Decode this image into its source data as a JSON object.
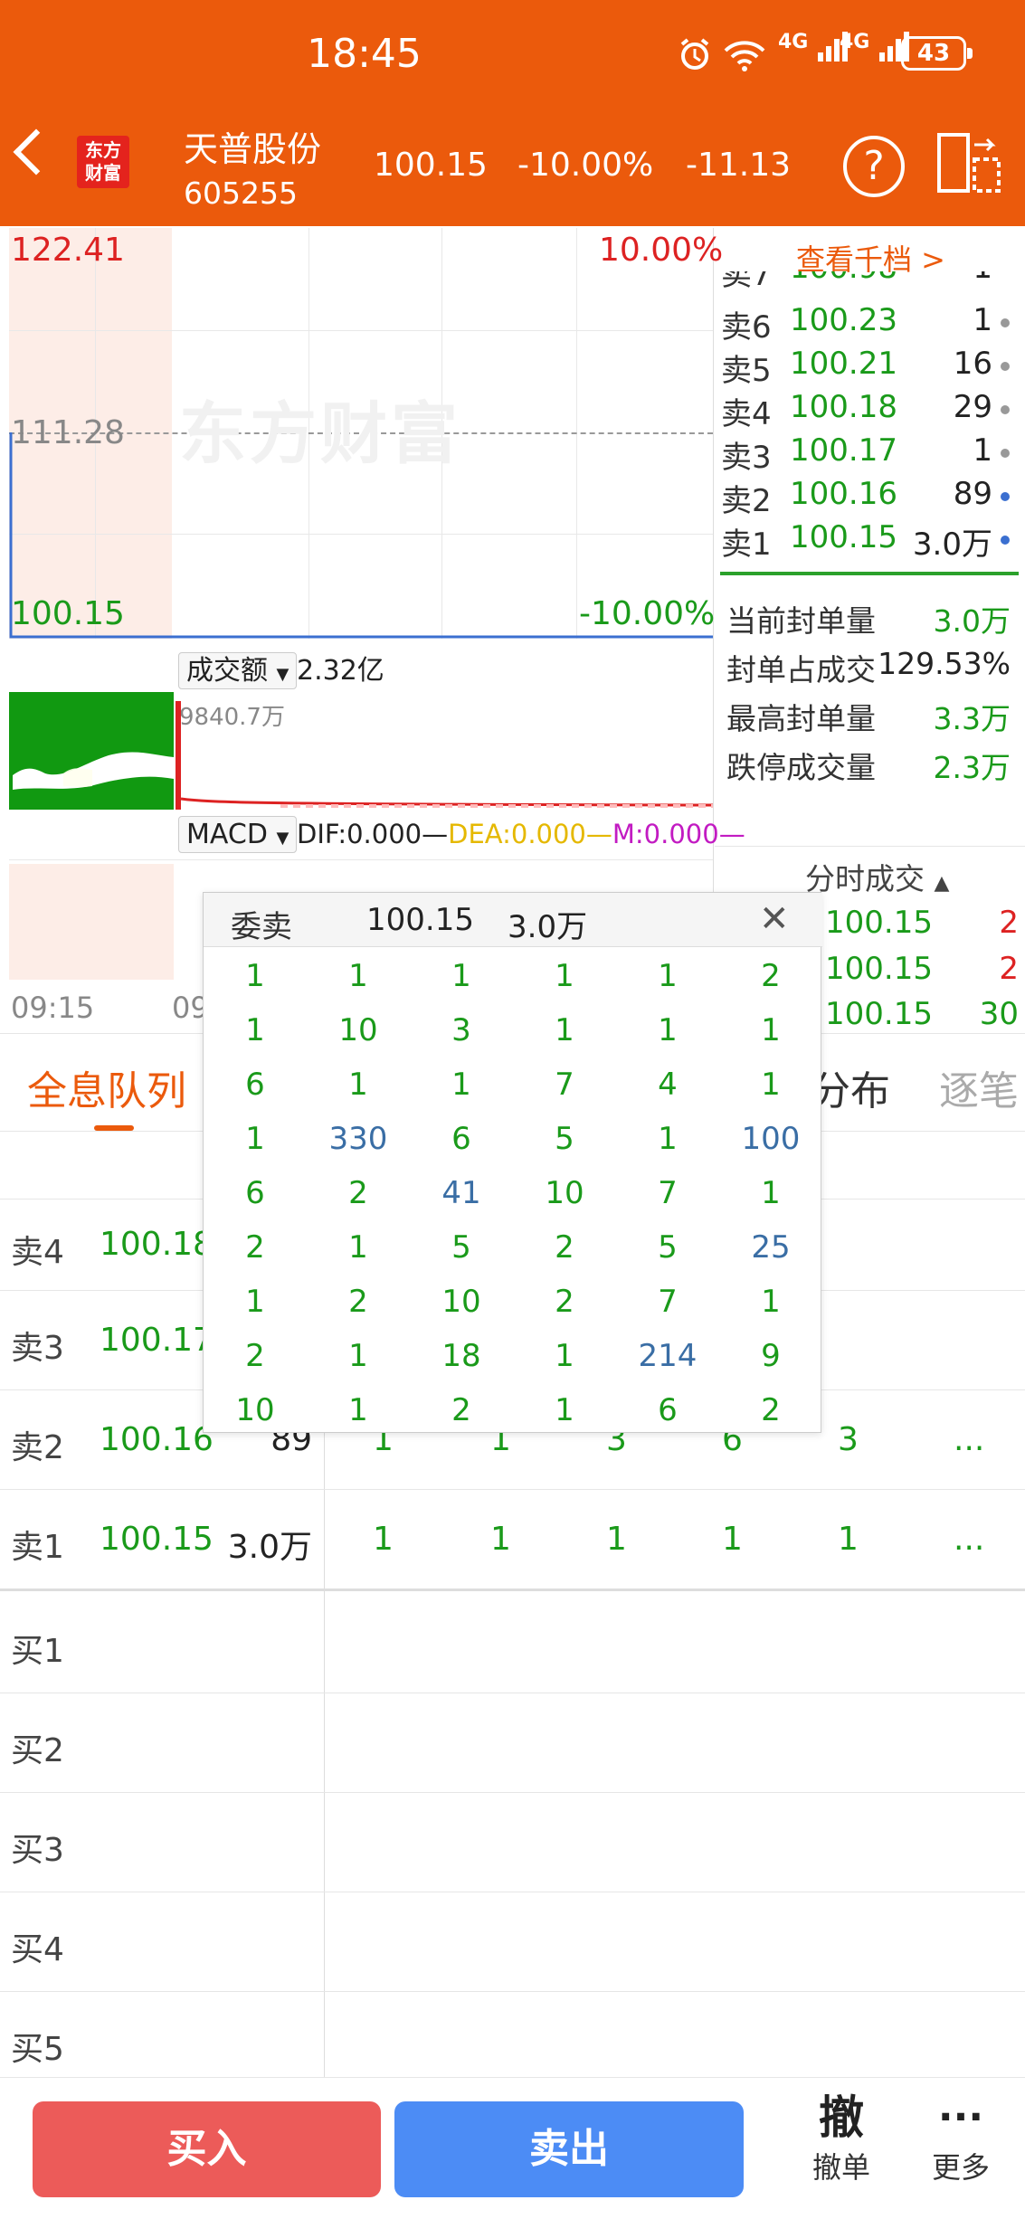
{
  "status_bar": {
    "time": "18:45",
    "net1": "4G",
    "net2": "4G",
    "battery": "43"
  },
  "header": {
    "logo_text_line1": "东方",
    "logo_text_line2": "财富",
    "stock_name": "天普股份",
    "stock_code": "605255",
    "price": "100.15",
    "change_pct": "-10.00%",
    "change_abs": "-11.13",
    "help_label": "?"
  },
  "chart": {
    "high_price": "122.41",
    "high_pct": "10.00%",
    "prev_close": "111.28",
    "low_price": "100.15",
    "low_pct": "-10.00%",
    "watermark": "东方财富",
    "turnover_selector": "成交额",
    "turnover_value": "2.32亿",
    "volume_max": "9840.7万",
    "macd_selector": "MACD",
    "dif": "DIF:0.000",
    "dea": "DEA:0.000",
    "m": "M:0.000",
    "time_start": "09:15",
    "time_partial": "09"
  },
  "order_book": {
    "view_thousand": "查看千档 >",
    "sell_levels": [
      {
        "label": "卖7",
        "price": "100.98",
        "vol": "1"
      },
      {
        "label": "卖6",
        "price": "100.23",
        "vol": "1"
      },
      {
        "label": "卖5",
        "price": "100.21",
        "vol": "16"
      },
      {
        "label": "卖4",
        "price": "100.18",
        "vol": "29"
      },
      {
        "label": "卖3",
        "price": "100.17",
        "vol": "1"
      },
      {
        "label": "卖2",
        "price": "100.16",
        "vol": "89"
      },
      {
        "label": "卖1",
        "price": "100.15",
        "vol": "3.0万"
      }
    ],
    "stats": [
      {
        "label": "当前封单量",
        "value": "3.0万"
      },
      {
        "label": "封单占成交",
        "value": "129.53%"
      },
      {
        "label": "最高封单量",
        "value": "3.3万"
      },
      {
        "label": "跌停成交量",
        "value": "2.3万"
      }
    ],
    "tick_title": "分时成交",
    "ticks": [
      {
        "price": "100.15",
        "vol": "2"
      },
      {
        "price": "100.15",
        "vol": "2"
      },
      {
        "price": "100.15",
        "vol": "30"
      }
    ]
  },
  "tabs": {
    "full_queue": "全息队列",
    "distribution": "分布",
    "tick_by_tick": "逐笔"
  },
  "queue_rows": [
    {
      "label": "卖4",
      "price": "100.18",
      "vol": "",
      "q": []
    },
    {
      "label": "卖3",
      "price": "100.17",
      "vol": "",
      "q": []
    },
    {
      "label": "卖2",
      "price": "100.16",
      "vol": "89",
      "q": [
        "1",
        "1",
        "3",
        "6",
        "3",
        "..."
      ]
    },
    {
      "label": "卖1",
      "price": "100.15",
      "vol": "3.0万",
      "q": [
        "1",
        "1",
        "1",
        "1",
        "1",
        "..."
      ]
    }
  ],
  "buy_rows": [
    "买1",
    "买2",
    "买3",
    "买4",
    "买5"
  ],
  "popup": {
    "title": "委卖",
    "price": "100.15",
    "vol": "3.0万",
    "close": "✕",
    "grid": [
      [
        "1",
        "1",
        "1",
        "1",
        "1",
        "2"
      ],
      [
        "1",
        "10",
        "3",
        "1",
        "1",
        "1"
      ],
      [
        "6",
        "1",
        "1",
        "7",
        "4",
        "1"
      ],
      [
        "1",
        "330",
        "6",
        "5",
        "1",
        "100"
      ],
      [
        "6",
        "2",
        "41",
        "10",
        "7",
        "1"
      ],
      [
        "2",
        "1",
        "5",
        "2",
        "5",
        "25"
      ],
      [
        "1",
        "2",
        "10",
        "2",
        "7",
        "1"
      ],
      [
        "2",
        "1",
        "18",
        "1",
        "214",
        "9"
      ],
      [
        "10",
        "1",
        "2",
        "1",
        "6",
        "2"
      ]
    ],
    "blue_cells": [
      "330",
      "100",
      "41",
      "25",
      "214"
    ]
  },
  "bottom": {
    "buy": "买入",
    "sell": "卖出",
    "cancel_icon_text": "撤",
    "cancel": "撤单",
    "more_icon": "···",
    "more": "更多"
  }
}
